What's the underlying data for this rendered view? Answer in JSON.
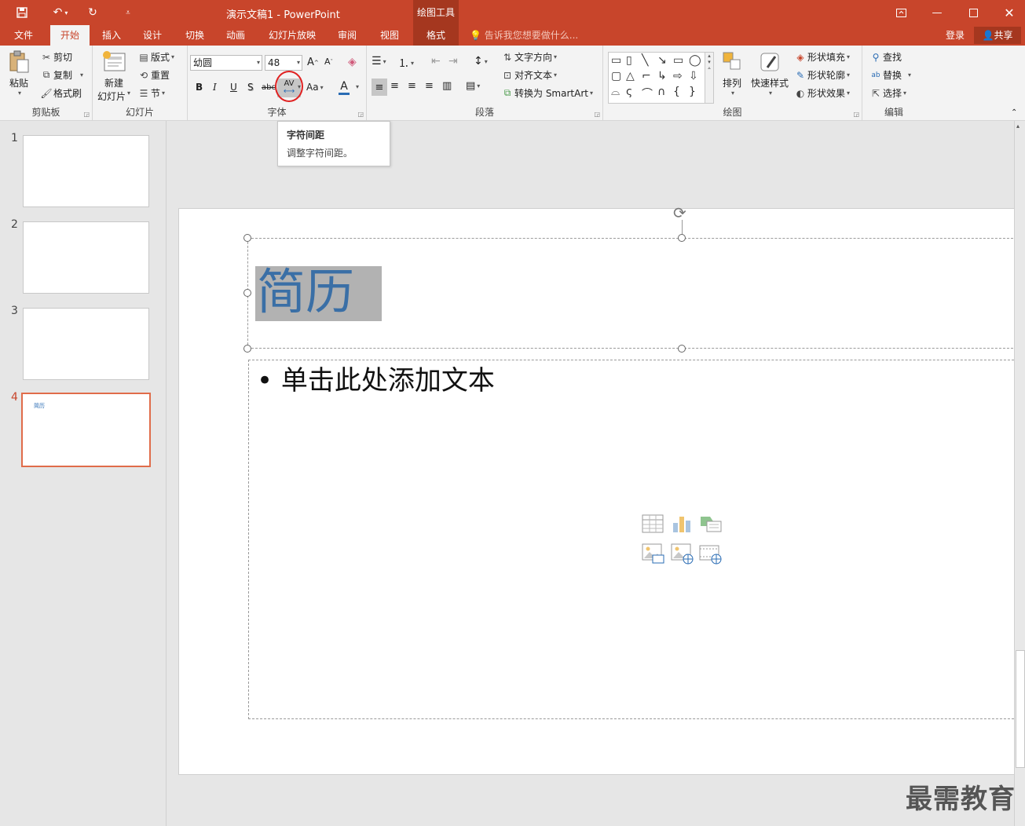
{
  "window": {
    "title": "演示文稿1 - PowerPoint",
    "context_tab_header": "绘图工具"
  },
  "colors": {
    "accent": "#c8452b",
    "accent_dark": "#a5371f",
    "title_text": "#3a6fa6"
  },
  "tabs": [
    {
      "label": "文件"
    },
    {
      "label": "开始",
      "active": true
    },
    {
      "label": "插入"
    },
    {
      "label": "设计"
    },
    {
      "label": "切换"
    },
    {
      "label": "动画"
    },
    {
      "label": "幻灯片放映"
    },
    {
      "label": "审阅"
    },
    {
      "label": "视图"
    },
    {
      "label": "格式"
    }
  ],
  "tellme": "告诉我您想要做什么...",
  "account": {
    "login": "登录",
    "share": "共享"
  },
  "ribbon": {
    "clipboard": {
      "paste": "粘贴",
      "cut": "剪切",
      "copy": "复制",
      "format_painter": "格式刷",
      "label": "剪贴板"
    },
    "slides": {
      "new_slide_l1": "新建",
      "new_slide_l2": "幻灯片",
      "layout": "版式",
      "reset": "重置",
      "section": "节",
      "label": "幻灯片"
    },
    "font": {
      "font_name": "幼圆",
      "font_size": "48",
      "bold": "B",
      "italic": "I",
      "underline": "U",
      "shadow": "S",
      "strike": "abc",
      "char_spacing": "AV",
      "change_case": "Aa",
      "font_color": "A",
      "label": "字体"
    },
    "paragraph": {
      "text_direction": "文字方向",
      "align_text": "对齐文本",
      "smartart": "转换为 SmartArt",
      "label": "段落"
    },
    "drawing": {
      "arrange": "排列",
      "quick_styles": "快速样式",
      "shape_fill": "形状填充",
      "shape_outline": "形状轮廓",
      "shape_effects": "形状效果",
      "label": "绘图"
    },
    "editing": {
      "find": "查找",
      "replace": "替换",
      "select": "选择",
      "label": "编辑"
    }
  },
  "tooltip": {
    "title": "字符间距",
    "desc": "调整字符间距。"
  },
  "thumbnails": [
    {
      "num": "1",
      "text": ""
    },
    {
      "num": "2",
      "text": ""
    },
    {
      "num": "3",
      "text": ""
    },
    {
      "num": "4",
      "text": "简历",
      "selected": true
    }
  ],
  "slide": {
    "title": "简历",
    "body": "单击此处添加文本",
    "content_placeholder_icons": [
      "table-icon",
      "chart-icon",
      "smartart-icon",
      "picture-icon",
      "online-picture-icon",
      "video-icon"
    ]
  },
  "watermark": "最需教育"
}
